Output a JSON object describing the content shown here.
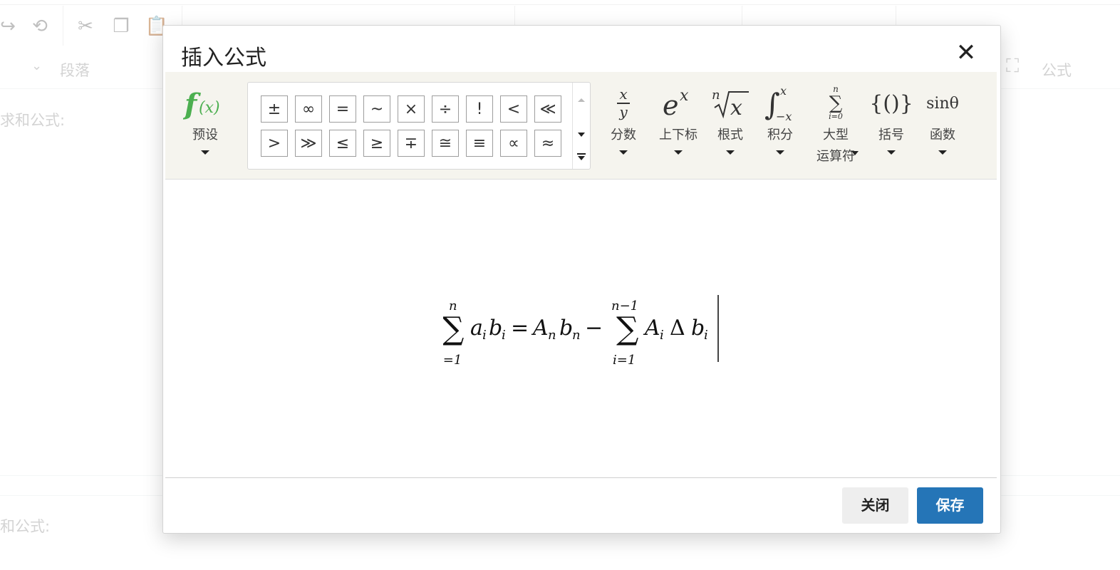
{
  "background": {
    "row2_heading_select": "段落",
    "row2_right_label": "公式",
    "text_line1": "求和公式:",
    "text_line2": "和公式:"
  },
  "dialog": {
    "title": "插入公式",
    "close_symbol": "✕",
    "ribbon": {
      "preset_label": "预设",
      "symbols": [
        "±",
        "∞",
        "=",
        "~",
        "×",
        "÷",
        "!",
        "<",
        "≪",
        ">",
        "≫",
        "≤",
        "≥",
        "∓",
        "≅",
        "≡",
        "∝",
        "≈"
      ],
      "categories": [
        {
          "label": "分数"
        },
        {
          "label": "上下标"
        },
        {
          "label": "根式"
        },
        {
          "label": "积分"
        },
        {
          "label": "大型\n运算符"
        },
        {
          "label": "括号"
        },
        {
          "label": "函数"
        }
      ]
    },
    "formula_text": "∑_{i=1}^{n} a_i b_i = A_n b_n − ∑_{i=1}^{n−1} A_i Δ b_i",
    "buttons": {
      "close": "关闭",
      "save": "保存"
    }
  },
  "colors": {
    "save_button": "#2575b7",
    "preset_icon": "#4caf50",
    "ribbon_bg": "#f5f4ee"
  }
}
